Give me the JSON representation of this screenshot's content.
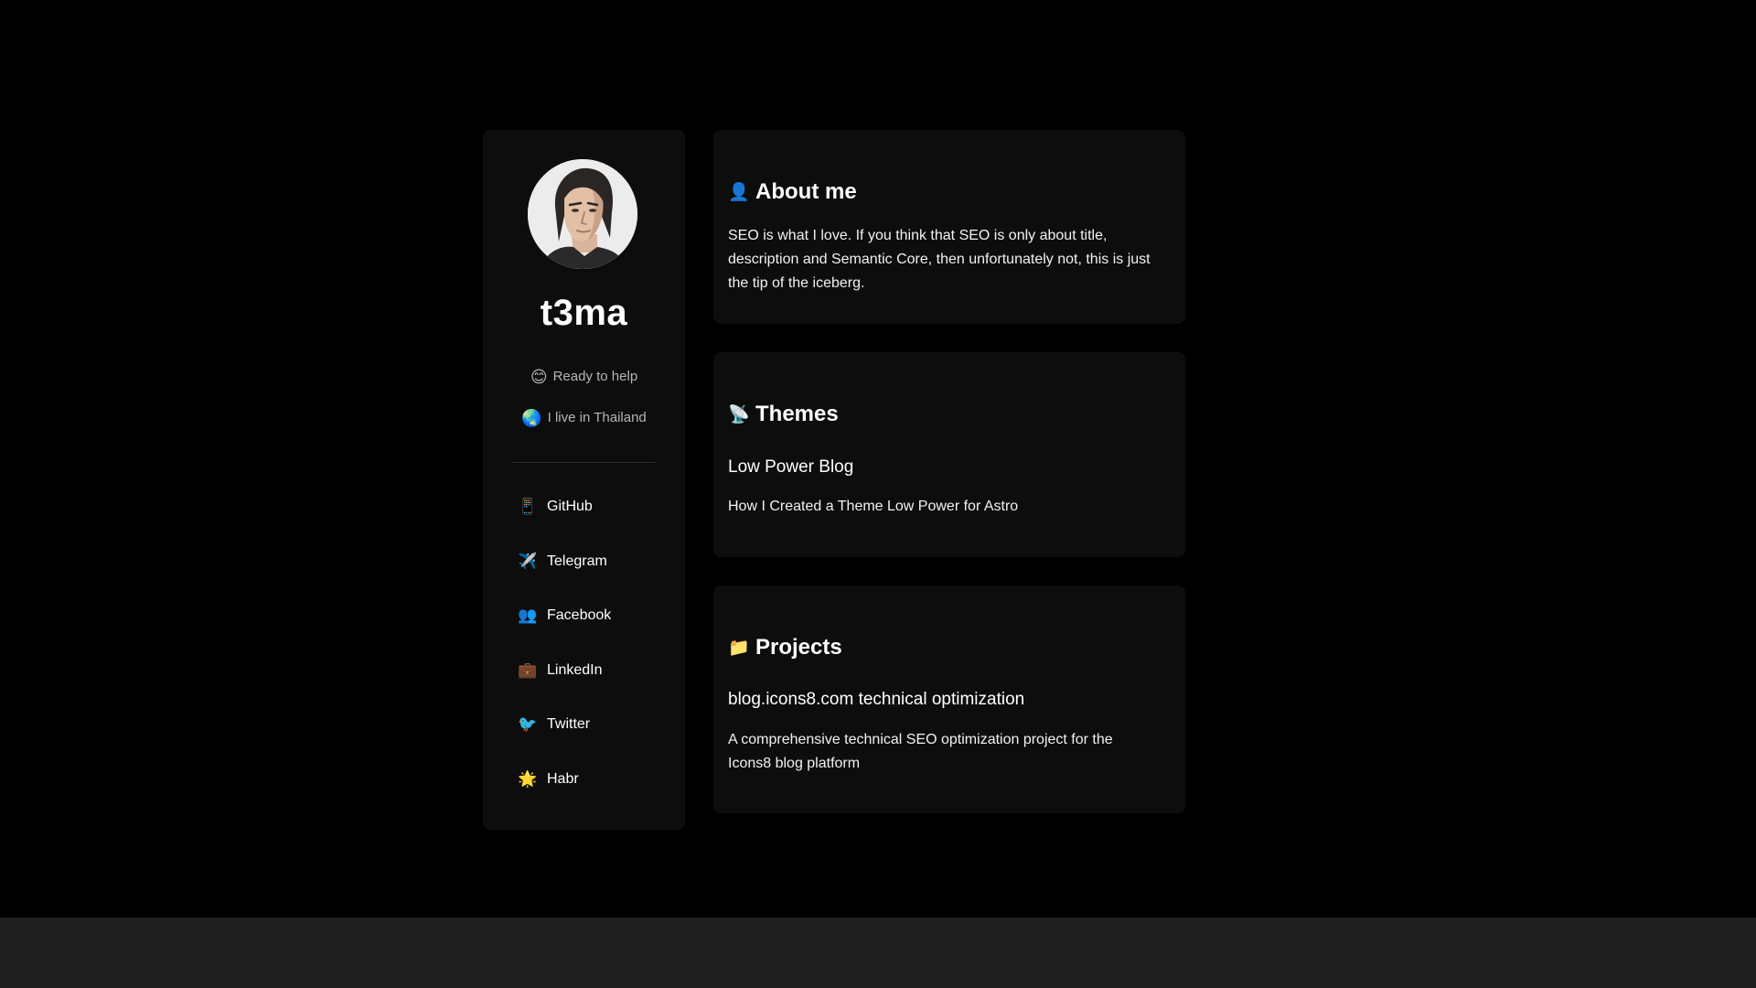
{
  "profile": {
    "name": "t3ma",
    "status_emoji": "😊",
    "status_text": "Ready to help",
    "location_emoji": "🌏",
    "location_text": "I live in Thailand"
  },
  "social_links": [
    {
      "icon": "mobile-phone-icon",
      "glyph": "📱",
      "label": "GitHub"
    },
    {
      "icon": "airplane-icon",
      "glyph": "✈️",
      "label": "Telegram"
    },
    {
      "icon": "people-icon",
      "glyph": "👥",
      "label": "Facebook"
    },
    {
      "icon": "briefcase-icon",
      "glyph": "💼",
      "label": "LinkedIn"
    },
    {
      "icon": "bird-icon",
      "glyph": "🐦",
      "label": "Twitter"
    },
    {
      "icon": "star-icon",
      "glyph": "🌟",
      "label": "Habr"
    }
  ],
  "about": {
    "icon": "person-icon",
    "glyph": "👤",
    "heading": "About me",
    "text": "SEO is what I love. If you think that SEO is only about title, description and Semantic Core, then unfortunately not, this is just the tip of the iceberg."
  },
  "themes": {
    "icon": "satellite-icon",
    "glyph": "📡",
    "heading": "Themes",
    "item_title": "Low Power Blog",
    "item_desc": "How I Created a Theme Low Power for Astro"
  },
  "projects": {
    "icon": "folder-icon",
    "glyph": "📁",
    "heading": "Projects",
    "item_title": "blog.icons8.com technical optimization",
    "item_desc": "A comprehensive technical SEO optimization project for the Icons8 blog platform"
  },
  "colors": {
    "background": "#000000",
    "card": "#0d0d0d",
    "footer_band": "#1f1f1f",
    "muted_text": "#b5b5b5"
  }
}
